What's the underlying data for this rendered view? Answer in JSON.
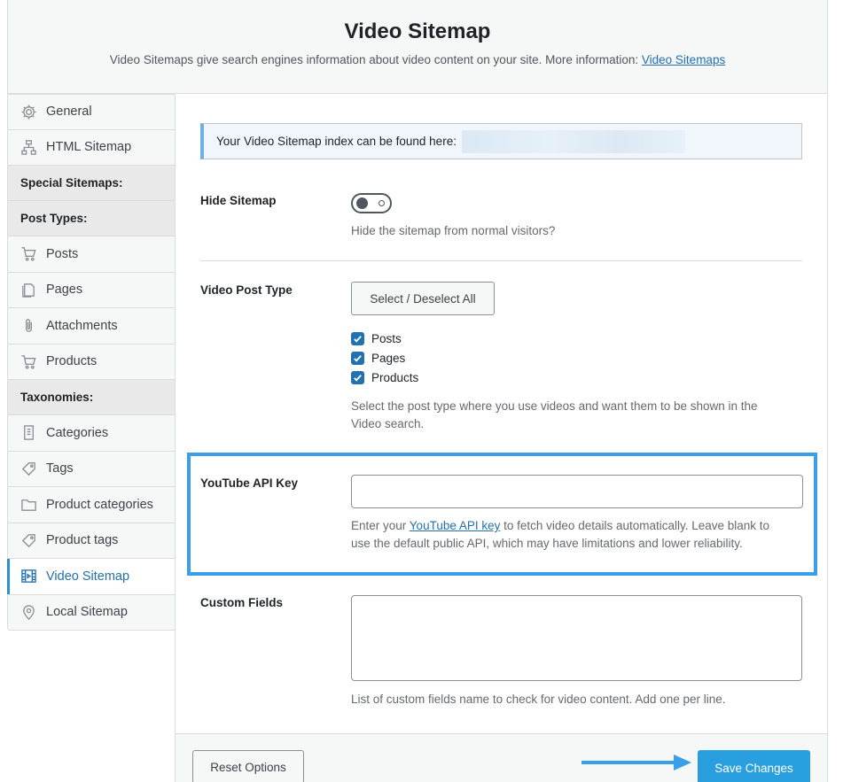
{
  "header": {
    "title": "Video Sitemap",
    "subtitle": "Video Sitemaps give search engines information about video content on your site. More information:",
    "link": "Video Sitemaps"
  },
  "sidebar": {
    "items": [
      {
        "label": "General",
        "icon": "gear-icon"
      },
      {
        "label": "HTML Sitemap",
        "icon": "sitemap-icon"
      },
      {
        "heading": "Special Sitemaps:"
      },
      {
        "heading": "Post Types:"
      },
      {
        "label": "Posts",
        "icon": "cart-icon"
      },
      {
        "label": "Pages",
        "icon": "page-icon"
      },
      {
        "label": "Attachments",
        "icon": "paperclip-icon"
      },
      {
        "label": "Products",
        "icon": "cart-icon"
      },
      {
        "heading": "Taxonomies:"
      },
      {
        "label": "Categories",
        "icon": "document-icon"
      },
      {
        "label": "Tags",
        "icon": "tag-icon"
      },
      {
        "label": "Product categories",
        "icon": "folder-icon"
      },
      {
        "label": "Product tags",
        "icon": "tag-icon"
      },
      {
        "label": "Video Sitemap",
        "icon": "video-icon",
        "active": true
      },
      {
        "label": "Local Sitemap",
        "icon": "location-pin-icon"
      }
    ]
  },
  "notice": {
    "text": "Your Video Sitemap index can be found here:"
  },
  "hide_sitemap": {
    "label": "Hide Sitemap",
    "description": "Hide the sitemap from normal visitors?",
    "enabled": false
  },
  "video_post_type": {
    "label": "Video Post Type",
    "select_all": "Select / Deselect All",
    "options": [
      {
        "label": "Posts",
        "checked": true
      },
      {
        "label": "Pages",
        "checked": true
      },
      {
        "label": "Products",
        "checked": true
      }
    ],
    "description_line1": "Select the post type where you use videos and want them to be shown in the",
    "description_line2": "Video search."
  },
  "youtube_api": {
    "label": "YouTube API Key",
    "value": "",
    "desc_prefix": "Enter your",
    "desc_link": "YouTube API key",
    "desc_suffix": "to fetch video details automatically. Leave blank to",
    "desc_line2": "use the default public API, which may have limitations and lower reliability."
  },
  "custom_fields": {
    "label": "Custom Fields",
    "value": "",
    "description": "List of custom fields name to check for video content. Add one per line."
  },
  "footer": {
    "reset": "Reset Options",
    "save": "Save Changes"
  },
  "colors": {
    "accent": "#2271b1",
    "highlight": "#3b9ee8",
    "primary_button": "#2a9fe0"
  }
}
